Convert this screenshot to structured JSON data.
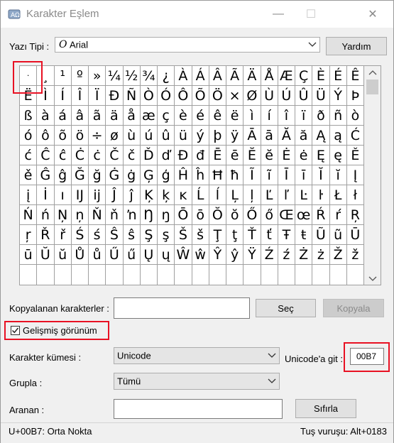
{
  "window": {
    "title": "Karakter Eşlem",
    "minimize": "—",
    "maximize": "☐",
    "close": "✕"
  },
  "font": {
    "label": "Yazı Tipi :",
    "value": "Arial",
    "font_icon": "O",
    "help_label": "Yardım"
  },
  "grid": {
    "rows": [
      [
        "·",
        "¸",
        "¹",
        "º",
        "»",
        "¼",
        "½",
        "¾",
        "¿",
        "À",
        "Á",
        "Â",
        "Ã",
        "Ä",
        "Å",
        "Æ",
        "Ç",
        "È",
        "É",
        "Ê"
      ],
      [
        "Ë",
        "Ì",
        "Í",
        "Î",
        "Ï",
        "Ð",
        "Ñ",
        "Ò",
        "Ó",
        "Ô",
        "Õ",
        "Ö",
        "×",
        "Ø",
        "Ù",
        "Ú",
        "Û",
        "Ü",
        "Ý",
        "Þ"
      ],
      [
        "ß",
        "à",
        "á",
        "â",
        "ã",
        "ä",
        "å",
        "æ",
        "ç",
        "è",
        "é",
        "ê",
        "ë",
        "ì",
        "í",
        "î",
        "ï",
        "ð",
        "ñ",
        "ò"
      ],
      [
        "ó",
        "ô",
        "õ",
        "ö",
        "÷",
        "ø",
        "ù",
        "ú",
        "û",
        "ü",
        "ý",
        "þ",
        "ÿ",
        "Ā",
        "ā",
        "Ă",
        "ă",
        "Ą",
        "ą",
        "Ć"
      ],
      [
        "ć",
        "Ĉ",
        "ĉ",
        "Ċ",
        "ċ",
        "Č",
        "č",
        "Ď",
        "ď",
        "Đ",
        "đ",
        "Ē",
        "ē",
        "Ĕ",
        "ĕ",
        "Ė",
        "ė",
        "Ę",
        "ę",
        "Ě"
      ],
      [
        "ě",
        "Ĝ",
        "ĝ",
        "Ğ",
        "ğ",
        "Ġ",
        "ġ",
        "Ģ",
        "ģ",
        "Ĥ",
        "ĥ",
        "Ħ",
        "ħ",
        "Ĩ",
        "ĩ",
        "Ī",
        "ī",
        "Ĭ",
        "ĭ",
        "Į"
      ],
      [
        "į",
        "İ",
        "ı",
        "Ĳ",
        "ĳ",
        "Ĵ",
        "ĵ",
        "Ķ",
        "ķ",
        "ĸ",
        "Ĺ",
        "ĺ",
        "Ļ",
        "ļ",
        "Ľ",
        "ľ",
        "Ŀ",
        "ŀ",
        "Ł",
        "ł"
      ],
      [
        "Ń",
        "ń",
        "Ņ",
        "ņ",
        "Ň",
        "ň",
        "ŉ",
        "Ŋ",
        "ŋ",
        "Ō",
        "ō",
        "Ŏ",
        "ŏ",
        "Ő",
        "ő",
        "Œ",
        "œ",
        "Ŕ",
        "ŕ",
        "Ŗ"
      ],
      [
        "ŗ",
        "Ř",
        "ř",
        "Ś",
        "ś",
        "Ŝ",
        "ŝ",
        "Ş",
        "ş",
        "Š",
        "š",
        "Ţ",
        "ţ",
        "Ť",
        "ť",
        "Ŧ",
        "ŧ",
        "Ũ",
        "ũ",
        "Ū"
      ],
      [
        "ū",
        "Ŭ",
        "ŭ",
        "Ů",
        "ů",
        "Ű",
        "ű",
        "Ų",
        "ų",
        "Ŵ",
        "ŵ",
        "Ŷ",
        "ŷ",
        "Ÿ",
        "Ź",
        "ź",
        "Ż",
        "ż",
        "Ž",
        "ž"
      ]
    ]
  },
  "copy": {
    "label": "Kopyalanan karakterler :",
    "value": "",
    "select_label": "Seç",
    "copy_label": "Kopyala"
  },
  "advanced": {
    "label": "Gelişmiş görünüm",
    "checked": true
  },
  "charset": {
    "label": "Karakter kümesi :",
    "value": "Unicode"
  },
  "goto": {
    "label": "Unicode'a git :",
    "value": "00B7"
  },
  "group": {
    "label": "Grupla :",
    "value": "Tümü"
  },
  "search": {
    "label": "Aranan :",
    "value": "",
    "reset_label": "Sıfırla"
  },
  "status": {
    "left": "U+00B7: Orta Nokta",
    "right": "Tuş vuruşu: Alt+0183"
  },
  "colors": {
    "highlight": "#e81123"
  }
}
